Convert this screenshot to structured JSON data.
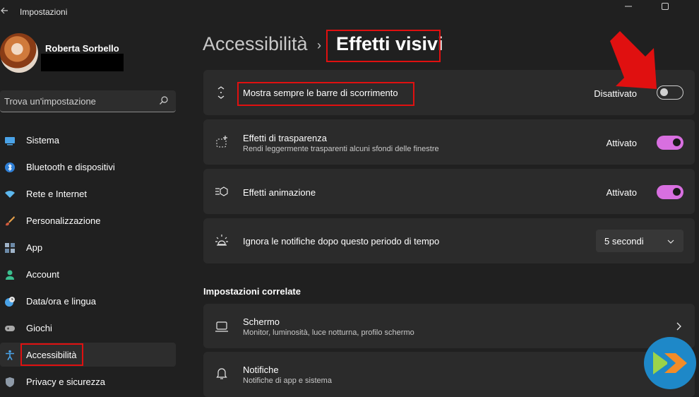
{
  "window": {
    "title": "Impostazioni"
  },
  "profile": {
    "name": "Roberta Sorbello"
  },
  "search": {
    "placeholder": "Trova un'impostazione"
  },
  "nav": [
    {
      "label": "Sistema",
      "icon": "monitor-icon"
    },
    {
      "label": "Bluetooth e dispositivi",
      "icon": "bluetooth-icon"
    },
    {
      "label": "Rete e Internet",
      "icon": "wifi-icon"
    },
    {
      "label": "Personalizzazione",
      "icon": "brush-icon"
    },
    {
      "label": "App",
      "icon": "apps-icon"
    },
    {
      "label": "Account",
      "icon": "person-icon"
    },
    {
      "label": "Data/ora e lingua",
      "icon": "globe-clock-icon"
    },
    {
      "label": "Giochi",
      "icon": "gamepad-icon"
    },
    {
      "label": "Accessibilità",
      "icon": "accessibility-icon",
      "active": true
    },
    {
      "label": "Privacy e sicurezza",
      "icon": "shield-icon"
    }
  ],
  "breadcrumb": {
    "parent": "Accessibilità",
    "separator": "›",
    "current": "Effetti visivi"
  },
  "settings": [
    {
      "title": "Mostra sempre le barre di scorrimento",
      "state": "Disattivato",
      "on": false
    },
    {
      "title": "Effetti di trasparenza",
      "subtitle": "Rendi leggermente trasparenti alcuni sfondi delle finestre",
      "state": "Attivato",
      "on": true
    },
    {
      "title": "Effetti animazione",
      "state": "Attivato",
      "on": true
    },
    {
      "title": "Ignora le notifiche dopo questo periodo di tempo",
      "dropdown": "5 secondi"
    }
  ],
  "related": {
    "title": "Impostazioni correlate",
    "items": [
      {
        "title": "Schermo",
        "subtitle": "Monitor, luminosità, luce notturna, profilo schermo"
      },
      {
        "title": "Notifiche",
        "subtitle": "Notifiche di app e sistema"
      }
    ]
  },
  "colors": {
    "accent": "#d86fe0",
    "highlight": "#e01010",
    "background": "#202020",
    "card": "#2b2b2b"
  }
}
